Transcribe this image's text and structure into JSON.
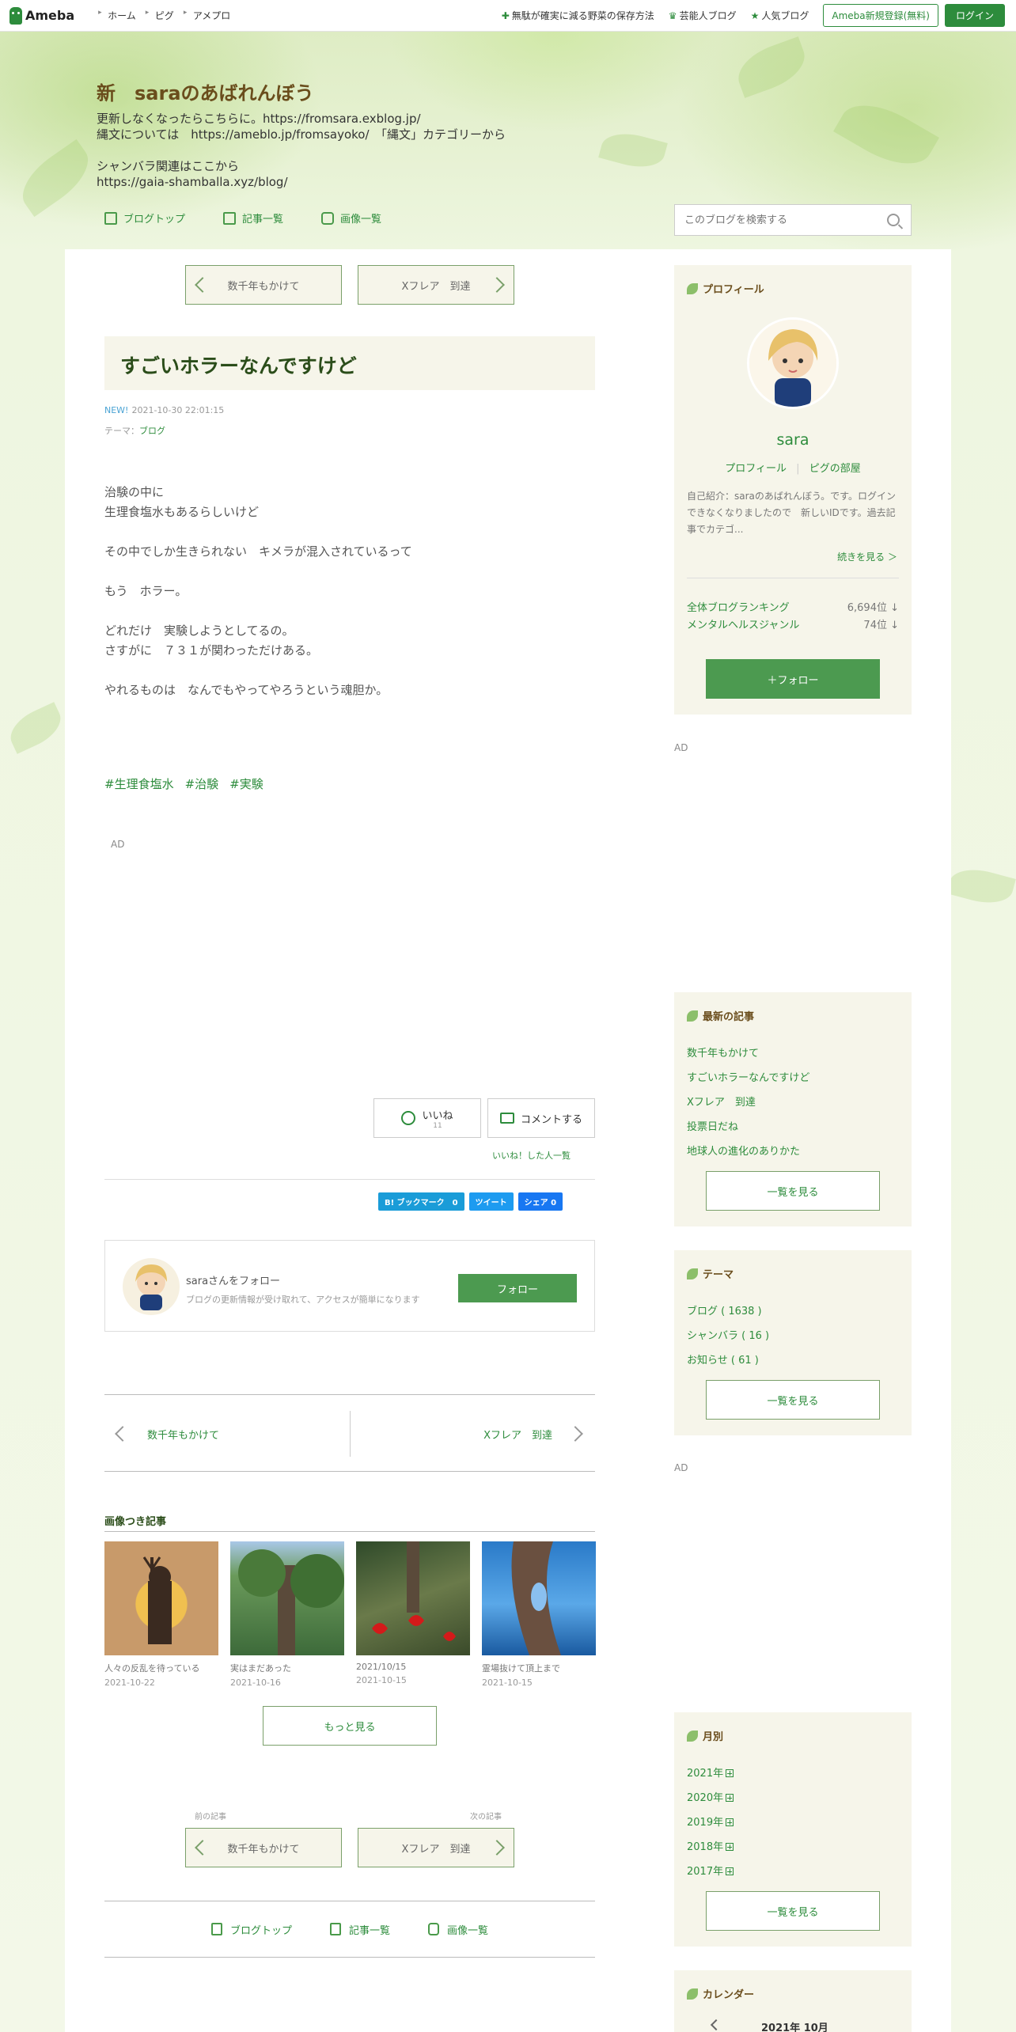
{
  "global_bar": {
    "logo": "Ameba",
    "nav": [
      "ホーム",
      "ピグ",
      "アメプロ"
    ],
    "promos": [
      "無駄が確実に減る野菜の保存方法",
      "芸能人ブログ",
      "人気ブログ"
    ],
    "register": "Ameba新規登録(無料)",
    "login": "ログイン"
  },
  "header": {
    "title": "新　saraのあばれんぼう",
    "description": "更新しなくなったらこちらに。https://fromsara.exblog.jp/\n縄文については　https://ameblo.jp/fromsayoko/　「縄文」カテゴリーから\n\nシャンバラ関連はここから\nhttps://gaia-shamballa.xyz/blog/",
    "nav": [
      "ブログトップ",
      "記事一覧",
      "画像一覧"
    ],
    "search_placeholder": "このブログを検索する"
  },
  "pager": {
    "prev": "数千年もかけて",
    "next": "Xフレア　到達"
  },
  "article": {
    "title": "すごいホラーなんですけど",
    "new_badge": "NEW!",
    "datetime": "2021-10-30 22:01:15",
    "theme_label": "テーマ：",
    "theme": "ブログ",
    "body": [
      "治験の中に",
      "生理食塩水もあるらしいけど",
      "",
      "その中でしか生きられない　キメラが混入されているって",
      "",
      "もう　ホラー。",
      "",
      "どれだけ　実験しようとしてるの。",
      "さすがに　７３１が関わっただけある。",
      "",
      "やれるものは　なんでもやってやろうという魂胆か。"
    ],
    "tags": [
      "#生理食塩水",
      "#治験",
      "#実験"
    ],
    "ad": "AD"
  },
  "reactions": {
    "like": "いいね",
    "like_count": "11",
    "comment": "コメントする",
    "likers": "いいね！した人一覧"
  },
  "share": {
    "hatena": "B! ブックマーク　0",
    "tweet": "ツイート",
    "facebook": "シェア 0"
  },
  "follow_box": {
    "title": "saraさんをフォロー",
    "desc": "ブログの更新情報が受け取れて、アクセスが簡単になります",
    "button": "フォロー"
  },
  "bottom_nav": {
    "prev": "数千年もかけて",
    "next": "Xフレア　到達"
  },
  "image_articles": {
    "title": "画像つき記事",
    "items": [
      {
        "caption": "人々の反乱を待っている",
        "date": "2021-10-22"
      },
      {
        "caption": "実はまだあった",
        "date": "2021-10-16"
      },
      {
        "caption": "2021/10/15",
        "date": "2021-10-15"
      },
      {
        "caption": "霊場抜けて頂上まで",
        "date": "2021-10-15"
      }
    ],
    "more": "もっと見る"
  },
  "footer_pager": {
    "prev_label": "前の記事",
    "next_label": "次の記事",
    "prev": "数千年もかけて",
    "next": "Xフレア　到達"
  },
  "footer_nav": [
    "ブログトップ",
    "記事一覧",
    "画像一覧"
  ],
  "sidebar": {
    "profile": {
      "heading": "プロフィール",
      "name": "sara",
      "links": [
        "プロフィール",
        "ピグの部屋"
      ],
      "intro": "自己紹介：saraのあばれんぼう。です。ログインできなくなりましたので　新しいIDです。過去記事でカテゴ...",
      "more": "続きを見る ＞",
      "rank1_label": "全体ブログランキング",
      "rank1_value": "6,694位 ↓",
      "rank2_label": "メンタルヘルスジャンル",
      "rank2_value": "74位 ↓",
      "follow": "＋フォロー"
    },
    "ad1": "AD",
    "latest": {
      "heading": "最新の記事",
      "items": [
        "数千年もかけて",
        "すごいホラーなんですけど",
        "Xフレア　到達",
        "投票日だね",
        "地球人の進化のありかた"
      ],
      "button": "一覧を見る"
    },
    "themes": {
      "heading": "テーマ",
      "items": [
        "ブログ ( 1638 )",
        "シャンバラ ( 16 )",
        "お知らせ ( 61 )"
      ],
      "button": "一覧を見る"
    },
    "ad2": "AD",
    "monthly": {
      "heading": "月別",
      "items": [
        "2021年",
        "2020年",
        "2019年",
        "2018年",
        "2017年"
      ],
      "button": "一覧を見る"
    },
    "calendar": {
      "heading": "カレンダー",
      "month": "2021年 10月"
    }
  },
  "colors": {
    "accent": "#2d8c3c",
    "title_brown": "#6a4d1c",
    "sidebar_bg": "#f6f5ea"
  }
}
